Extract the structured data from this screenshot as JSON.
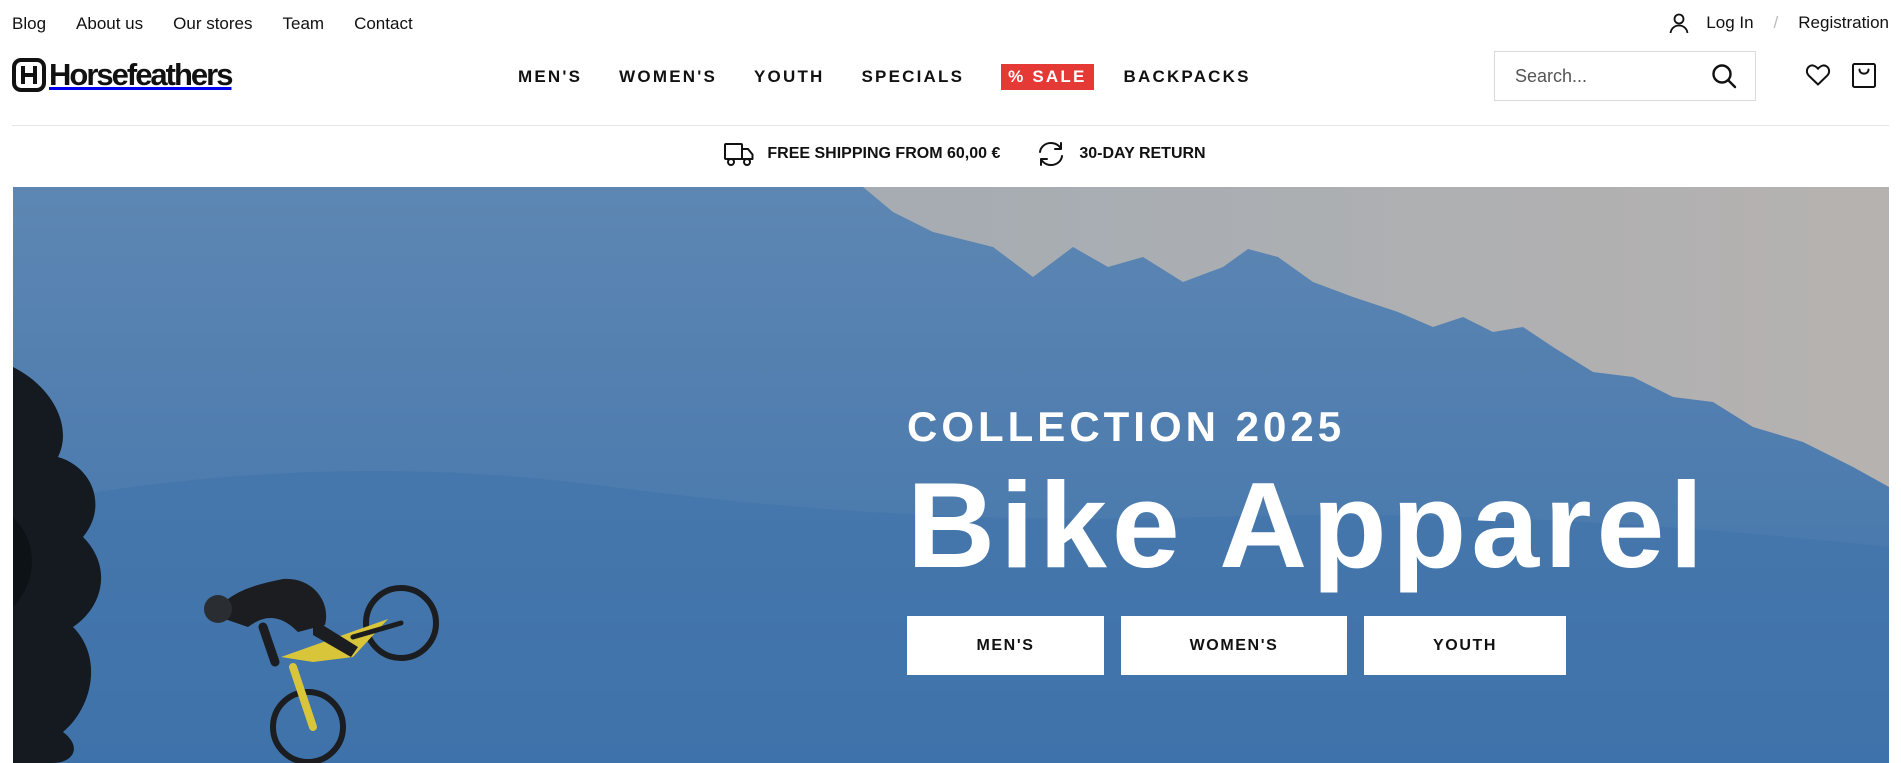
{
  "top_links": [
    "Blog",
    "About us",
    "Our stores",
    "Team",
    "Contact"
  ],
  "account": {
    "login": "Log In",
    "separator": "/",
    "register": "Registration"
  },
  "logo": {
    "text": "Horsefeathers"
  },
  "nav": {
    "mens": "MEN'S",
    "womens": "WOMEN'S",
    "youth": "YOUTH",
    "specials": "SPECIALS",
    "sale": "% SALE",
    "backpacks": "BACKPACKS"
  },
  "search": {
    "placeholder": "Search..."
  },
  "benefits": {
    "shipping": "FREE SHIPPING FROM 60,00 €",
    "returns": "30-DAY RETURN"
  },
  "hero": {
    "kicker": "COLLECTION 2025",
    "headline": "Bike Apparel",
    "buttons": {
      "mens": "MEN'S",
      "womens": "WOMEN'S",
      "youth": "YOUTH"
    }
  },
  "colors": {
    "sale_bg": "#e53935",
    "hero_sky": "#4578ad",
    "text": "#111111"
  },
  "icons": {
    "user": "user-icon",
    "search": "search-icon",
    "wishlist": "heart-icon",
    "cart": "shopping-bag-icon",
    "shipping": "truck-icon",
    "returns": "return-arrows-icon"
  }
}
